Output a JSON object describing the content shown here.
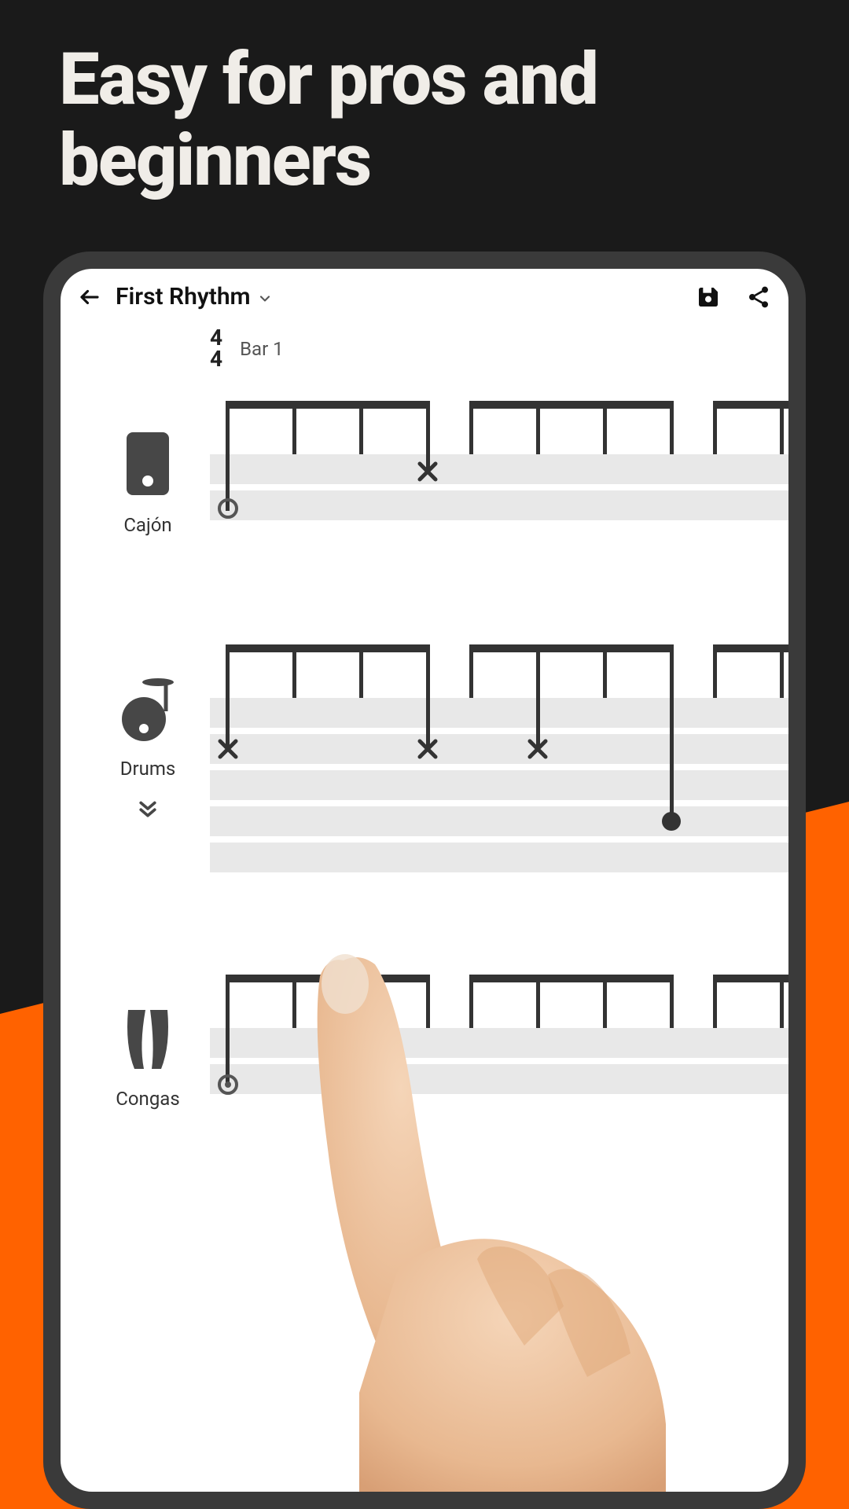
{
  "headline": "Easy for pros and beginners",
  "header": {
    "title": "First Rhythm"
  },
  "meta": {
    "time_sig_top": "4",
    "time_sig_bottom": "4",
    "bar_label": "Bar 1"
  },
  "tracks": [
    {
      "name": "Cajón"
    },
    {
      "name": "Drums"
    },
    {
      "name": "Congas"
    }
  ]
}
